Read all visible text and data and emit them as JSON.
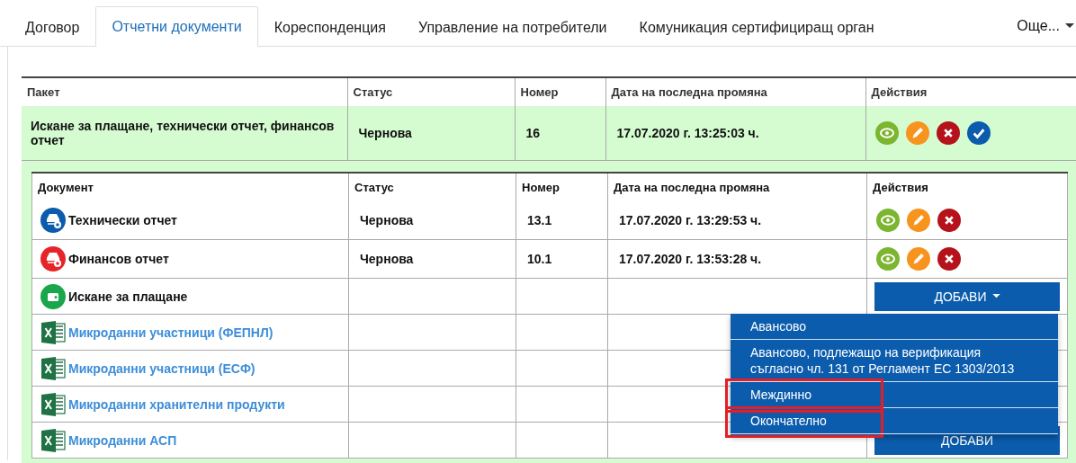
{
  "tabs": [
    {
      "label": "Договор",
      "selected": false
    },
    {
      "label": "Отчетни документи",
      "selected": true
    },
    {
      "label": "Кореспонденция",
      "selected": false
    },
    {
      "label": "Управление на потребители",
      "selected": false
    },
    {
      "label": "Комуникация сертифициращ орган",
      "selected": false
    }
  ],
  "more_tab": {
    "label": "Още..."
  },
  "package_table": {
    "columns": [
      "Пакет",
      "Статус",
      "Номер",
      "Дата на последна промяна",
      "Действия"
    ],
    "rows": [
      {
        "package": "Искане за плащане, технически отчет, финансов отчет",
        "status": "Чернова",
        "number": "16",
        "modified": "17.07.2020 г. 13:25:03 ч.",
        "actions": [
          {
            "kind": "view"
          },
          {
            "kind": "edit"
          },
          {
            "kind": "delete"
          },
          {
            "kind": "approve"
          }
        ]
      }
    ]
  },
  "document_table": {
    "columns": [
      "Документ",
      "Статус",
      "Номер",
      "Дата на последна промяна",
      "Действия"
    ],
    "rows": [
      {
        "kind": "technical",
        "name": "Технически отчет",
        "status": "Чернова",
        "number": "13.1",
        "modified": "17.07.2020 г. 13:29:53 ч.",
        "actions": [
          {
            "kind": "view"
          },
          {
            "kind": "edit"
          },
          {
            "kind": "delete"
          }
        ]
      },
      {
        "kind": "financial",
        "name": "Финансов отчет",
        "status": "Чернова",
        "number": "10.1",
        "modified": "17.07.2020 г. 13:53:28 ч.",
        "actions": [
          {
            "kind": "view"
          },
          {
            "kind": "edit"
          },
          {
            "kind": "delete"
          }
        ]
      },
      {
        "kind": "payment",
        "name": "Искане за плащане",
        "add_button": {
          "label": "ДОБАВИ",
          "caret": true
        }
      },
      {
        "kind": "excel",
        "name": "Микроданни участници (ФЕПНЛ)"
      },
      {
        "kind": "excel",
        "name": "Микроданни участници (ЕСФ)"
      },
      {
        "kind": "excel",
        "name": "Микроданни хранителни продукти"
      },
      {
        "kind": "excel",
        "name": "Микроданни АСП",
        "add_button": {
          "label": "ДОБАВИ"
        }
      }
    ]
  },
  "add_menu": {
    "items": [
      {
        "label": "Авансово",
        "highlighted": false
      },
      {
        "label": "Авансово, подлежащо на верификация съгласно чл. 131 от Регламент ЕС 1303/2013",
        "highlighted": false
      },
      {
        "label": "Междинно",
        "highlighted": true
      },
      {
        "label": "Окончателно",
        "highlighted": true
      }
    ]
  }
}
